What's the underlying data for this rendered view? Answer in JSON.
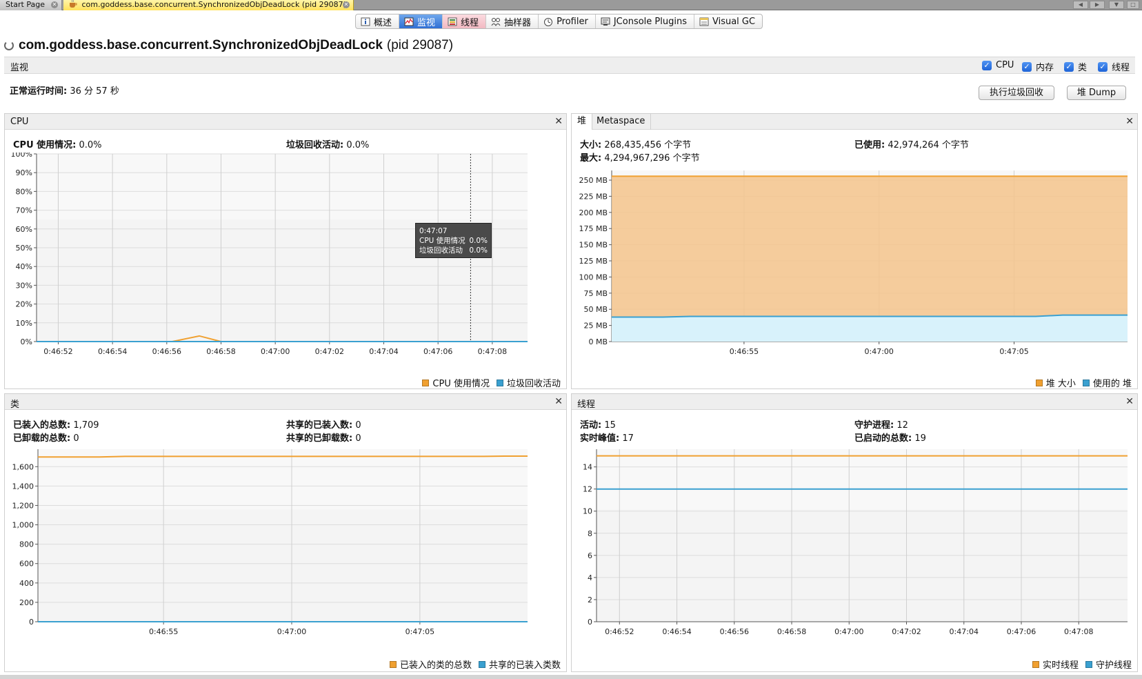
{
  "doc_tabs": [
    {
      "label": "Start Page",
      "active": false
    },
    {
      "label": "com.goddess.base.concurrent.SynchronizedObjDeadLock (pid 29087)",
      "active": true
    }
  ],
  "view_tabs": [
    {
      "label": "概述",
      "icon": "info-icon"
    },
    {
      "label": "监视",
      "icon": "monitor-icon",
      "selected": true
    },
    {
      "label": "线程",
      "icon": "threads-icon"
    },
    {
      "label": "抽样器",
      "icon": "sampler-icon"
    },
    {
      "label": "Profiler",
      "icon": "profiler-icon"
    },
    {
      "label": "JConsole Plugins",
      "icon": "jconsole-icon"
    },
    {
      "label": "Visual GC",
      "icon": "visualgc-icon"
    }
  ],
  "header": {
    "title": "com.goddess.base.concurrent.SynchronizedObjDeadLock",
    "pid": "(pid 29087)"
  },
  "monitor_bar": {
    "label": "监视",
    "checks": [
      {
        "label": "CPU",
        "checked": true
      },
      {
        "label": "内存",
        "checked": true
      },
      {
        "label": "类",
        "checked": true
      },
      {
        "label": "线程",
        "checked": true
      }
    ]
  },
  "uptime": {
    "label": "正常运行时间:",
    "value": "36 分 57 秒"
  },
  "buttons": {
    "gc": "执行垃圾回收",
    "heap_dump": "堆 Dump"
  },
  "colors": {
    "orange": "#f0a030",
    "blue": "#3aa0d0",
    "orange_fill": "#f5c48c",
    "blue_fill": "#d8f2fb"
  },
  "cpu_panel": {
    "title": "CPU",
    "stats": [
      {
        "label": "CPU 使用情况:",
        "value": "0.0%"
      },
      {
        "label": "垃圾回收活动:",
        "value": "0.0%"
      }
    ],
    "legend": [
      "CPU 使用情况",
      "垃圾回收活动"
    ],
    "tooltip": {
      "time": "0:47:07",
      "rows": [
        {
          "label": "CPU 使用情况",
          "value": "0.0%"
        },
        {
          "label": "垃圾回收活动",
          "value": "0.0%"
        }
      ]
    }
  },
  "heap_panel": {
    "tabs": [
      "堆",
      "Metaspace"
    ],
    "stats": [
      {
        "label": "大小:",
        "value": "268,435,456 个字节"
      },
      {
        "label": "已使用:",
        "value": "42,974,264 个字节"
      },
      {
        "label": "最大:",
        "value": "4,294,967,296 个字节"
      }
    ],
    "legend": [
      "堆 大小",
      "使用的 堆"
    ]
  },
  "classes_panel": {
    "title": "类",
    "stats": [
      {
        "label": "已装入的总数:",
        "value": "1,709"
      },
      {
        "label": "共享的已装入数:",
        "value": "0"
      },
      {
        "label": "已卸载的总数:",
        "value": "0"
      },
      {
        "label": "共享的已卸载数:",
        "value": "0"
      }
    ],
    "legend": [
      "已装入的类的总数",
      "共享的已装入类数"
    ]
  },
  "threads_panel": {
    "title": "线程",
    "stats": [
      {
        "label": "活动:",
        "value": "15"
      },
      {
        "label": "守护进程:",
        "value": "12"
      },
      {
        "label": "实时峰值:",
        "value": "17"
      },
      {
        "label": "已启动的总数:",
        "value": "19"
      }
    ],
    "legend": [
      "实时线程",
      "守护线程"
    ]
  },
  "chart_data": [
    {
      "id": "cpu",
      "type": "line",
      "x_ticks": [
        "0:46:52",
        "0:46:54",
        "0:46:56",
        "0:46:58",
        "0:47:00",
        "0:47:02",
        "0:47:04",
        "0:47:06",
        "0:47:08"
      ],
      "y_ticks": [
        "100%",
        "90%",
        "80%",
        "70%",
        "60%",
        "50%",
        "40%",
        "30%",
        "20%",
        "10%",
        "0%"
      ],
      "ylim": [
        0,
        100
      ],
      "xlim": [
        51.2,
        69.3
      ],
      "cursor_x": 67.2,
      "series": [
        {
          "name": "CPU 使用情况",
          "color": "#f0a030",
          "points": [
            [
              51.2,
              0
            ],
            [
              56.2,
              0
            ],
            [
              57.2,
              3
            ],
            [
              58.0,
              0
            ],
            [
              69.3,
              0
            ]
          ]
        },
        {
          "name": "垃圾回收活动",
          "color": "#3aa0d0",
          "points": [
            [
              51.2,
              0
            ],
            [
              69.3,
              0
            ]
          ]
        }
      ]
    },
    {
      "id": "heap",
      "type": "area",
      "x_ticks": [
        "0:46:55",
        "0:47:00",
        "0:47:05"
      ],
      "y_ticks": [
        "250 MB",
        "225 MB",
        "200 MB",
        "175 MB",
        "150 MB",
        "125 MB",
        "100 MB",
        "75 MB",
        "50 MB",
        "25 MB",
        "0 MB"
      ],
      "ylim": [
        0,
        265
      ],
      "xlim": [
        50.1,
        69.2
      ],
      "series": [
        {
          "name": "堆 大小",
          "color": "#f0a030",
          "points": [
            [
              50.1,
              256
            ],
            [
              69.2,
              256
            ]
          ]
        },
        {
          "name": "使用的 堆",
          "color": "#3aa0d0",
          "points": [
            [
              50.1,
              38
            ],
            [
              52.0,
              38
            ],
            [
              53.0,
              39
            ],
            [
              65.8,
              39
            ],
            [
              66.8,
              41
            ],
            [
              69.2,
              41
            ]
          ]
        }
      ]
    },
    {
      "id": "classes",
      "type": "line",
      "x_ticks": [
        "0:46:55",
        "0:47:00",
        "0:47:05"
      ],
      "y_ticks": [
        "1,600",
        "1,400",
        "1,200",
        "1,000",
        "800",
        "600",
        "400",
        "200",
        "0"
      ],
      "ylim": [
        0,
        1780
      ],
      "xlim": [
        50.1,
        69.2
      ],
      "series": [
        {
          "name": "已装入的类的总数",
          "color": "#f0a030",
          "points": [
            [
              50.1,
              1700
            ],
            [
              52.5,
              1700
            ],
            [
              53.5,
              1706
            ],
            [
              67.5,
              1706
            ],
            [
              68.3,
              1709
            ],
            [
              69.2,
              1709
            ]
          ]
        },
        {
          "name": "共享的已装入类数",
          "color": "#3aa0d0",
          "points": [
            [
              50.1,
              0
            ],
            [
              69.2,
              0
            ]
          ]
        }
      ]
    },
    {
      "id": "threads",
      "type": "line",
      "x_ticks": [
        "0:46:52",
        "0:46:54",
        "0:46:56",
        "0:46:58",
        "0:47:00",
        "0:47:02",
        "0:47:04",
        "0:47:06",
        "0:47:08"
      ],
      "y_ticks": [
        "14",
        "12",
        "10",
        "8",
        "6",
        "4",
        "2",
        "0"
      ],
      "ylim": [
        0,
        15.6
      ],
      "xlim": [
        51.2,
        69.7
      ],
      "series": [
        {
          "name": "实时线程",
          "color": "#f0a030",
          "points": [
            [
              51.2,
              15
            ],
            [
              69.7,
              15
            ]
          ]
        },
        {
          "name": "守护线程",
          "color": "#3aa0d0",
          "points": [
            [
              51.2,
              12
            ],
            [
              69.7,
              12
            ]
          ]
        }
      ]
    }
  ]
}
